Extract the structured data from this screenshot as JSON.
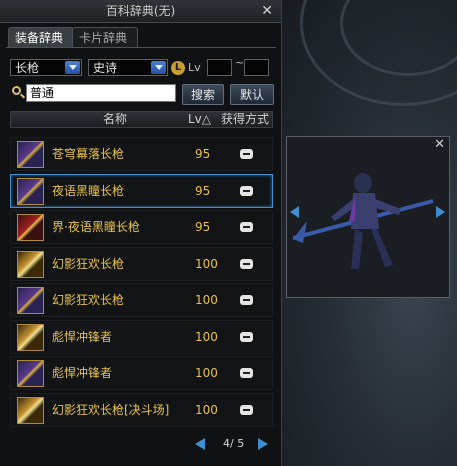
{
  "window": {
    "title": "百科辞典(无)",
    "close_glyph": "✕"
  },
  "tabs": [
    {
      "label": "装备辞典",
      "active": true
    },
    {
      "label": "卡片辞典",
      "active": false
    }
  ],
  "filters": {
    "weapon_type": "长枪",
    "rarity": "史诗",
    "lv_label": "Lv",
    "lv_icon_letter": "L",
    "lv_from": "",
    "lv_to": "",
    "lv_separator": "~"
  },
  "search": {
    "value": "普通",
    "search_button": "搜索",
    "default_button": "默认"
  },
  "table": {
    "columns": {
      "name": "名称",
      "level": "Lv△",
      "acquire": "获得方式"
    },
    "rows": [
      {
        "name": "苍穹幕落长枪",
        "level": "95",
        "icon": "spear-icon-purple",
        "selected": false
      },
      {
        "name": "夜语黑瞳长枪",
        "level": "95",
        "icon": "spear-icon-purple",
        "selected": true
      },
      {
        "name": "界·夜语黑瞳长枪",
        "level": "95",
        "icon": "spear-icon-red",
        "selected": false
      },
      {
        "name": "幻影狂欢长枪",
        "level": "100",
        "icon": "spear-icon-gold",
        "selected": false
      },
      {
        "name": "幻影狂欢长枪",
        "level": "100",
        "icon": "spear-icon-purple",
        "selected": false
      },
      {
        "name": "彪悍冲锋者",
        "level": "100",
        "icon": "spear-icon-gold",
        "selected": false
      },
      {
        "name": "彪悍冲锋者",
        "level": "100",
        "icon": "spear-icon-purple",
        "selected": false
      },
      {
        "name": "幻影狂欢长枪[决斗场]",
        "level": "100",
        "icon": "spear-icon-gold",
        "selected": false
      }
    ]
  },
  "pager": {
    "text": "4/ 5"
  },
  "preview": {
    "close_glyph": "✕"
  },
  "colors": {
    "accent_blue": "#3e8fd0",
    "item_name_gold": "#e8c24a"
  }
}
